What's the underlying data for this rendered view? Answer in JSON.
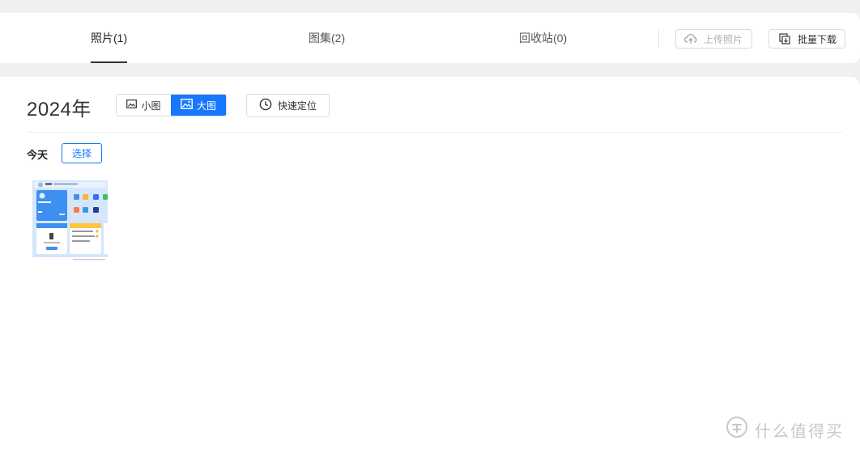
{
  "tabs": [
    {
      "label": "照片(1)",
      "active": true
    },
    {
      "label": "图集(2)",
      "active": false
    },
    {
      "label": "回收站(0)",
      "active": false
    }
  ],
  "toolbar": {
    "upload_label": "上传照片",
    "upload_icon": "cloud-upload-icon",
    "download_label": "批量下载",
    "download_icon": "copy-download-icon"
  },
  "main": {
    "year": "2024年",
    "view_toggle": {
      "small_label": "小图",
      "large_label": "大图",
      "selected": "大图",
      "accent": "#1677ff"
    },
    "locate_label": "快速定位",
    "locate_icon": "clock-icon"
  },
  "group": {
    "date_label": "今天",
    "select_label": "选择"
  },
  "watermark": {
    "text": "什么值得买"
  }
}
